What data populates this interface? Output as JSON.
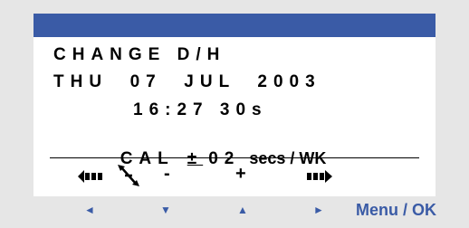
{
  "display": {
    "line1": "CHANGE D/H",
    "line2": "THU  07  JUL  2003",
    "line3": "16:27 30s",
    "cal": {
      "label": "CAL",
      "sign": "±",
      "value": "02",
      "unit": "secs / WK"
    }
  },
  "toolbar": {
    "icons": [
      "prev-field-icon",
      "swap-arrows-icon",
      "minus",
      "plus",
      "next-field-icon"
    ],
    "minus_label": "-",
    "plus_label": "+"
  },
  "keys": {
    "left": "◄",
    "down": "▼",
    "up": "▲",
    "right": "►",
    "menu_ok": "Menu / OK"
  },
  "colors": {
    "accent": "#3a5ba6",
    "background": "#e6e6e6",
    "screen": "#ffffff"
  }
}
